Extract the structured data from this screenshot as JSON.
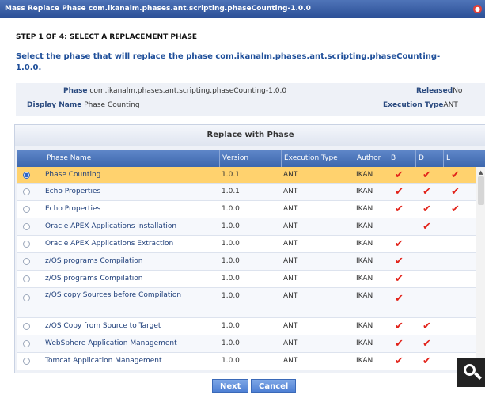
{
  "window": {
    "title": "Mass Replace Phase com.ikanalm.phases.ant.scripting.phaseCounting-1.0.0",
    "close_icon": "close-icon"
  },
  "step": "STEP 1 OF 4: SELECT A REPLACEMENT PHASE",
  "description": "Select the phase that will replace the phase com.ikanalm.phases.ant.scripting.phaseCounting-1.0.0.",
  "info": {
    "phase_label": "Phase",
    "phase_value": "com.ikanalm.phases.ant.scripting.phaseCounting-1.0.0",
    "display_name_label": "Display Name",
    "display_name_value": "Phase Counting",
    "released_label": "Released",
    "released_value": "No",
    "execution_type_label": "Execution Type",
    "execution_type_value": "ANT"
  },
  "panel_title": "Replace with Phase",
  "columns": [
    "Phase Name",
    "Version",
    "Execution Type",
    "Author",
    "B",
    "D",
    "L"
  ],
  "rows": [
    {
      "name": "Phase Counting",
      "version": "1.0.1",
      "exec": "ANT",
      "author": "IKAN",
      "b": "✔",
      "d": "✔",
      "l": "✔",
      "selected": true
    },
    {
      "name": "Echo Properties",
      "version": "1.0.1",
      "exec": "ANT",
      "author": "IKAN",
      "b": "✔",
      "d": "✔",
      "l": "✔",
      "selected": false
    },
    {
      "name": "Echo Properties",
      "version": "1.0.0",
      "exec": "ANT",
      "author": "IKAN",
      "b": "✔",
      "d": "✔",
      "l": "✔",
      "selected": false
    },
    {
      "name": "Oracle APEX Applications Installation",
      "version": "1.0.0",
      "exec": "ANT",
      "author": "IKAN",
      "b": "",
      "d": "✔",
      "l": "",
      "selected": false
    },
    {
      "name": "Oracle APEX Applications Extraction",
      "version": "1.0.0",
      "exec": "ANT",
      "author": "IKAN",
      "b": "✔",
      "d": "",
      "l": "",
      "selected": false
    },
    {
      "name": "z/OS programs Compilation",
      "version": "1.0.0",
      "exec": "ANT",
      "author": "IKAN",
      "b": "✔",
      "d": "",
      "l": "",
      "selected": false
    },
    {
      "name": "z/OS programs Compilation",
      "version": "1.0.0",
      "exec": "ANT",
      "author": "IKAN",
      "b": "✔",
      "d": "",
      "l": "",
      "selected": false
    },
    {
      "name": "z/OS copy Sources before Compilation",
      "version": "1.0.0",
      "exec": "ANT",
      "author": "IKAN",
      "b": "✔",
      "d": "",
      "l": "",
      "selected": false
    },
    {
      "name": "z/OS Copy from Source to Target",
      "version": "1.0.0",
      "exec": "ANT",
      "author": "IKAN",
      "b": "✔",
      "d": "✔",
      "l": "",
      "selected": false
    },
    {
      "name": "WebSphere Application Management",
      "version": "1.0.0",
      "exec": "ANT",
      "author": "IKAN",
      "b": "✔",
      "d": "✔",
      "l": "",
      "selected": false
    },
    {
      "name": "Tomcat Application Management",
      "version": "1.0.0",
      "exec": "ANT",
      "author": "IKAN",
      "b": "✔",
      "d": "✔",
      "l": "",
      "selected": false
    }
  ],
  "buttons": {
    "next": "Next",
    "cancel": "Cancel"
  },
  "icons": {
    "zoom": "magnifier-icon",
    "check": "check-icon",
    "radio": "radio-button"
  },
  "colors": {
    "title_bar": "#2b4f96",
    "header": "#3d67ad",
    "selected_row": "#ffd26e",
    "check": "#e2231a"
  }
}
